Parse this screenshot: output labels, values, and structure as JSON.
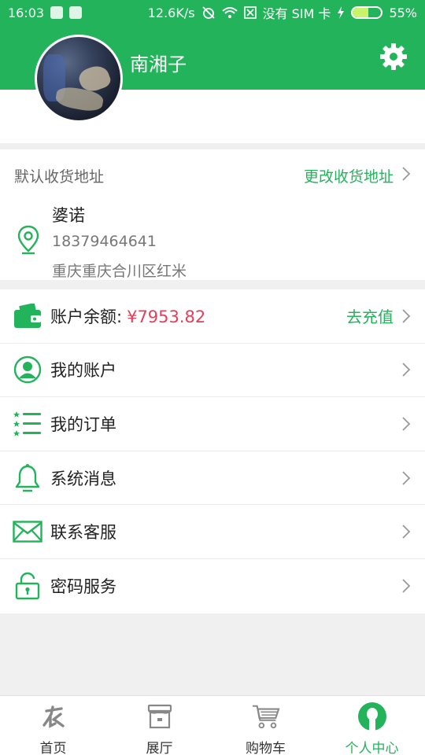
{
  "status_bar": {
    "time": "16:03",
    "network_speed": "12.6K/s",
    "sim_text": "没有 SIM 卡",
    "battery_percent": "55%",
    "battery_level": 0.55
  },
  "header": {
    "username": "南湘子",
    "settings_icon": "gear-icon"
  },
  "address": {
    "label": "默认收货地址",
    "change_label": "更改收货地址",
    "name": "婆诺",
    "phone": "18379464641",
    "detail": "重庆重庆合川区红米"
  },
  "menu": {
    "balance_label": "账户余额:",
    "balance_amount": "¥7953.82",
    "recharge_label": "去充值",
    "items": [
      {
        "label": "我的账户",
        "icon": "user-icon"
      },
      {
        "label": "我的订单",
        "icon": "list-icon"
      },
      {
        "label": "系统消息",
        "icon": "bell-icon"
      },
      {
        "label": "联系客服",
        "icon": "mail-icon"
      },
      {
        "label": "密码服务",
        "icon": "lock-icon"
      }
    ]
  },
  "tabs": [
    {
      "label": "首页",
      "icon": "home-nong-icon"
    },
    {
      "label": "展厅",
      "icon": "store-icon"
    },
    {
      "label": "购物车",
      "icon": "cart-icon"
    },
    {
      "label": "个人中心",
      "icon": "person-icon",
      "active": true
    }
  ],
  "colors": {
    "brand_green": "#23b35a",
    "amount_red": "#e53e5b",
    "background": "#f0f0f0"
  }
}
